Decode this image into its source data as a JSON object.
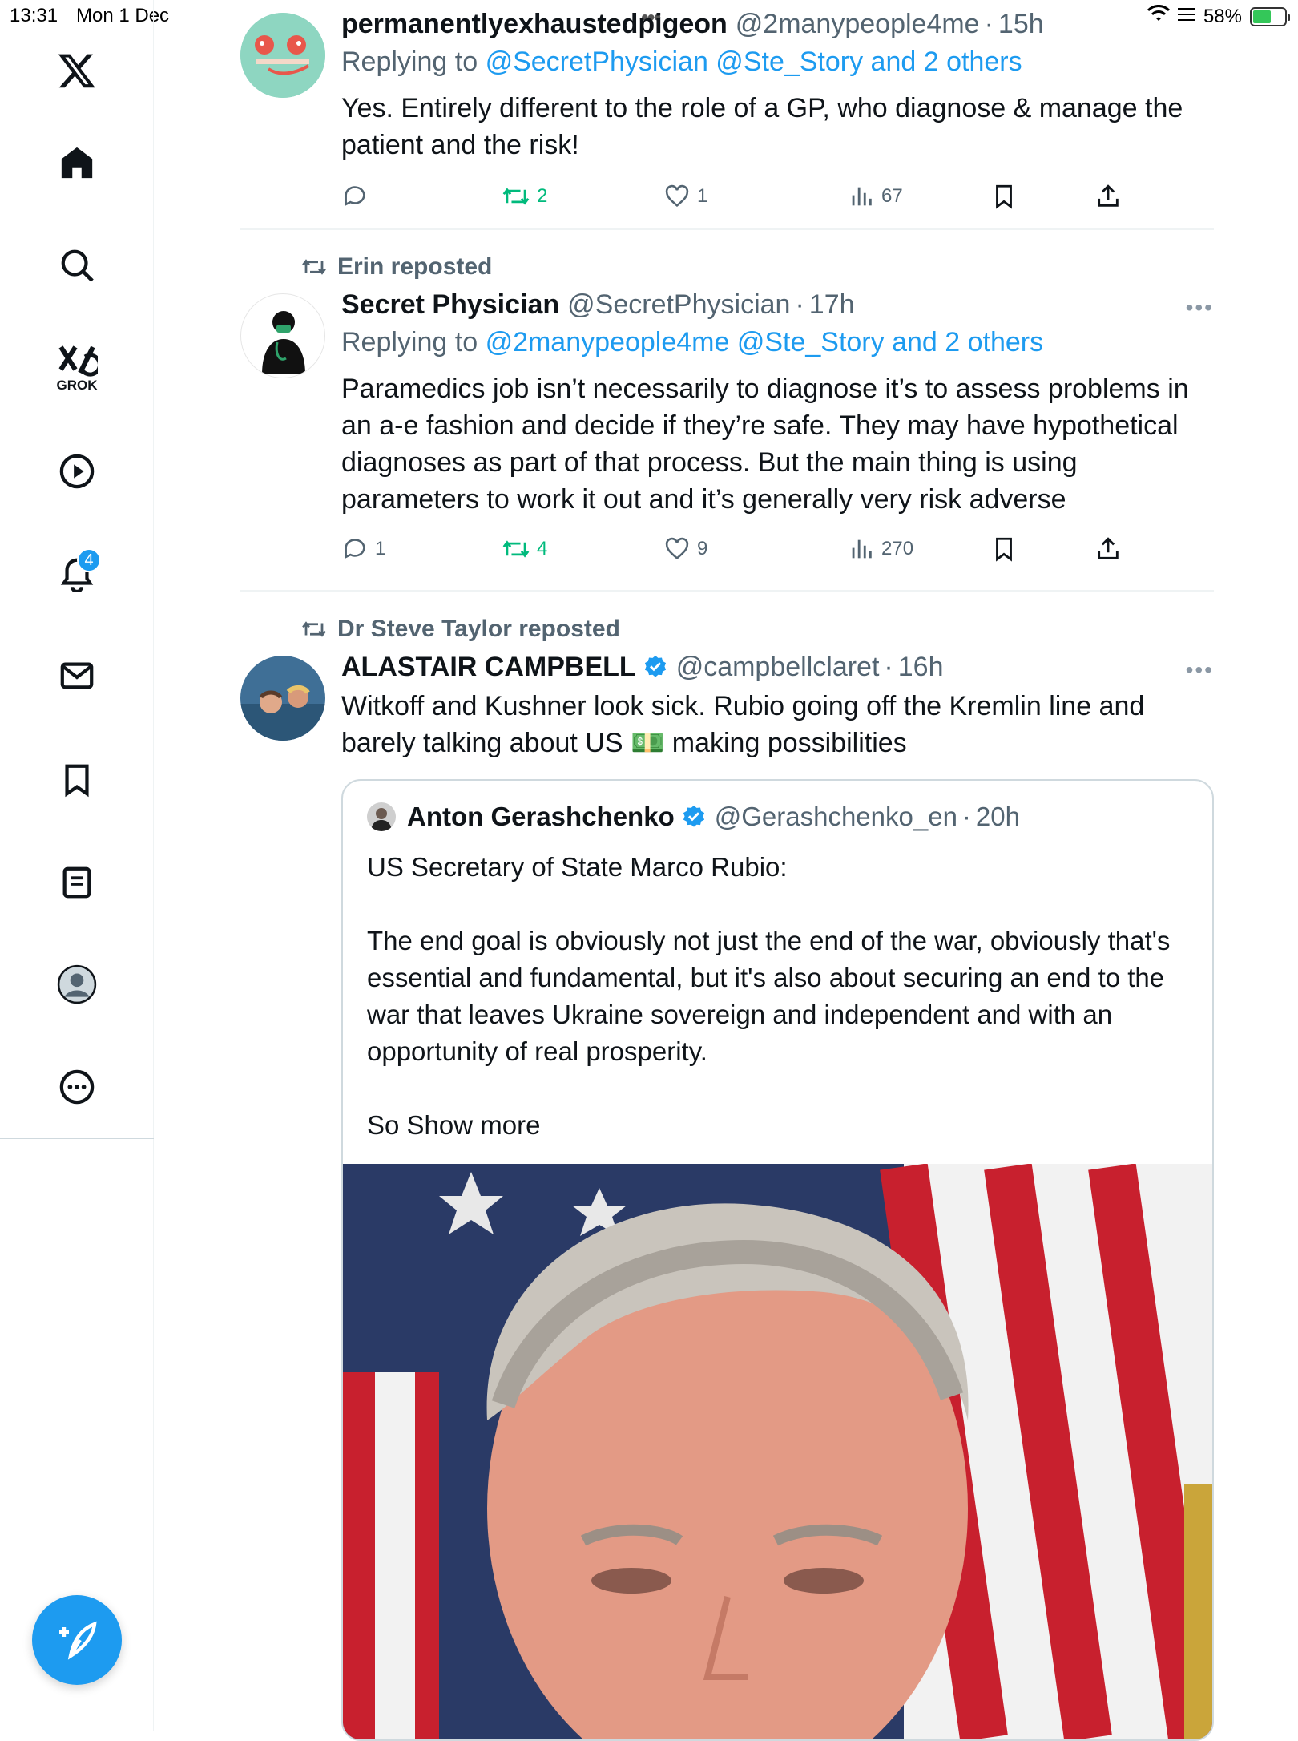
{
  "status_bar": {
    "time": "13:31",
    "date": "Mon 1 Dec",
    "battery": "58%",
    "battery_level": 0.58
  },
  "sidebar": {
    "items": [
      {
        "name": "x-logo",
        "label": ""
      },
      {
        "name": "home",
        "label": ""
      },
      {
        "name": "search",
        "label": ""
      },
      {
        "name": "grok",
        "label": "GROK"
      },
      {
        "name": "video",
        "label": ""
      },
      {
        "name": "notifications",
        "label": "",
        "badge": "4"
      },
      {
        "name": "messages",
        "label": ""
      },
      {
        "name": "bookmarks",
        "label": ""
      },
      {
        "name": "lists",
        "label": ""
      },
      {
        "name": "profile",
        "label": ""
      },
      {
        "name": "more",
        "label": ""
      }
    ]
  },
  "colors": {
    "accent": "#1d9bf0",
    "repost_green": "#00ba7c",
    "secondary_text": "#536471",
    "border": "#cfd9de"
  },
  "tweets": [
    {
      "name": "permanentlyexhaustedpigeon",
      "handle": "@2manypeople4me",
      "time": "15h",
      "reply_prefix": "Replying to",
      "reply_to": "@SecretPhysician @Ste_Story and 2 others",
      "text": "Yes. Entirely different to the role of a GP, who diagnose & manage the patient and the risk!",
      "stats": {
        "replies": "",
        "reposts": "2",
        "likes": "1",
        "views": "67"
      }
    },
    {
      "repost_by": "Erin reposted",
      "name": "Secret Physician",
      "handle": "@SecretPhysician",
      "time": "17h",
      "reply_prefix": "Replying to",
      "reply_to": "@2manypeople4me @Ste_Story and 2 others",
      "text": "Paramedics job isn’t necessarily to diagnose it’s to assess problems in an a-e fashion and decide if they’re safe. They may have hypothetical diagnoses as part of that process. But the main thing is using parameters to work it out and it’s generally very risk adverse",
      "stats": {
        "replies": "1",
        "reposts": "4",
        "likes": "9",
        "views": "270"
      }
    },
    {
      "repost_by": "Dr Steve Taylor reposted",
      "name": "ALASTAIR CAMPBELL",
      "handle": "@campbellclaret",
      "time": "16h",
      "text": "Witkoff and Kushner look sick. Rubio going off the Kremlin line and barely talking about US 💵 making possibilities",
      "quote": {
        "name": "Anton Gerashchenko",
        "handle": "@Gerashchenko_en",
        "time": "20h",
        "line1": "US Secretary of State Marco Rubio:",
        "line2": "The end goal is obviously not just the end of the war, obviously that's essential and fundamental, but it's also about securing an end to the war that leaves Ukraine sovereign and independent and with an opportunity of real prosperity.",
        "line3": "So Show more"
      }
    }
  ]
}
